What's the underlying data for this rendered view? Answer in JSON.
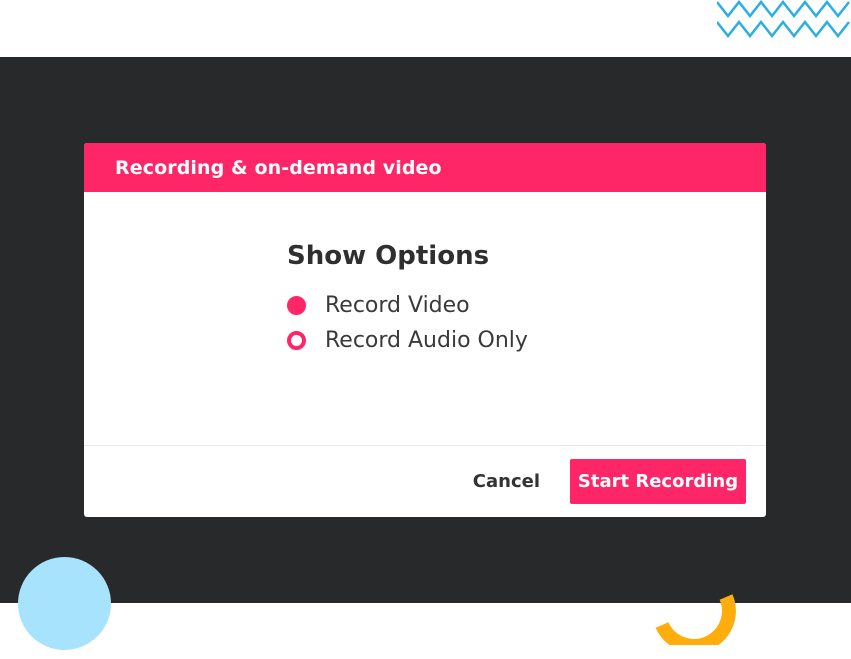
{
  "dialog": {
    "title": "Recording & on-demand video",
    "options_title": "Show Options",
    "options": [
      {
        "label": "Record Video",
        "selected": true
      },
      {
        "label": "Record Audio Only",
        "selected": false
      }
    ],
    "cancel_label": "Cancel",
    "start_label": "Start Recording"
  },
  "colors": {
    "accent": "#ff2667",
    "backdrop": "#28292b",
    "zigzag": "#29aee6",
    "circle": "#a8e3fd",
    "arc": "#ffac0d"
  },
  "decor_icons": [
    "zigzag-decoration",
    "circle-decoration",
    "arc-decoration"
  ]
}
